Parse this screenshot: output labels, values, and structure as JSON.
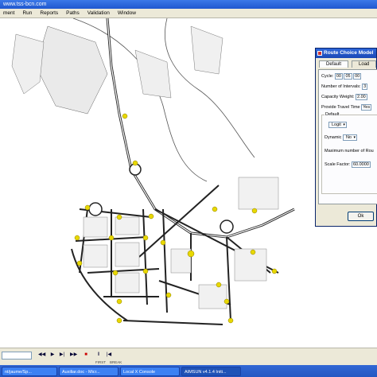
{
  "window": {
    "title": "www.tss-bcn.com"
  },
  "menu": [
    "ment",
    "Run",
    "Reports",
    "Paths",
    "Validation",
    "Window"
  ],
  "dialog": {
    "title": "Route Choice Model",
    "tabs": [
      "Default",
      "Load"
    ],
    "cycle_label": "Cycle:",
    "cycle_values": [
      "00",
      "05",
      "00"
    ],
    "intervals_label": "Number of Intervals:",
    "intervals_value": "3",
    "capacity_label": "Capacity Weight:",
    "capacity_value": "2.00",
    "travel_time_label": "Provide Travel Time",
    "travel_time_value": "Yes",
    "default_group_label": "Default",
    "model_value": "Logit",
    "dynamic_label": "Dynamic",
    "dynamic_value": "No",
    "max_routes_label": "Maximum number of Rou",
    "scale_factor_label": "Scale Factor:",
    "scale_factor_value": "60.0000",
    "ok_label": "Ok"
  },
  "transport": {
    "time_value": "",
    "labels": [
      "FIRST",
      "BREAK"
    ]
  },
  "taskbar": {
    "items": [
      "nt/jaume/Sp...",
      "Auxiliar.doc - Micr...",
      "Local X Console",
      "AIMSUN v4.1.4 Initi..."
    ]
  },
  "colors": {
    "node": "#e8d800",
    "road": "#222222",
    "title_blue": "#2e66d9"
  }
}
